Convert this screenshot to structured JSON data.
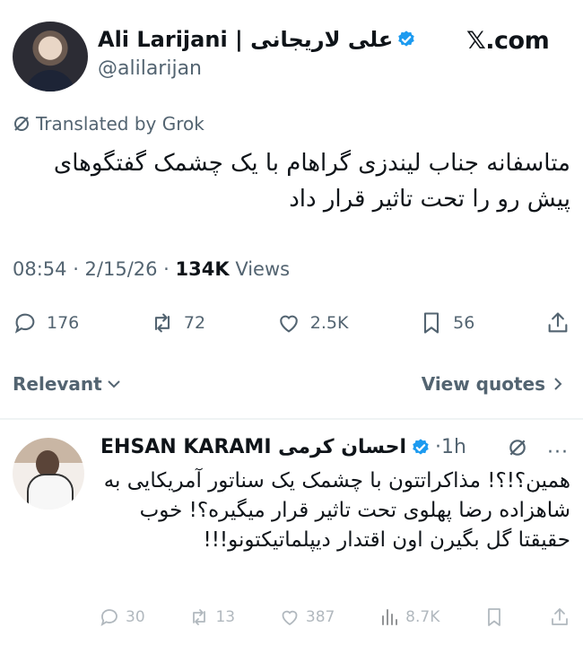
{
  "author": {
    "name": "Ali Larijani | علی لاریجانی",
    "handle": "@alilarijan"
  },
  "brand": "𝕏.com",
  "translated_label": "Translated by Grok",
  "tweet_text": "متاسفانه جناب لیندزی گراهام با یک چشمک گفتگوهای پیش رو را تحت تاثیر قرار داد",
  "meta": {
    "time_date": "08:54 · 2/15/26 · ",
    "views_count": "134K",
    "views_label": " Views"
  },
  "actions": {
    "replies": "176",
    "reposts": "72",
    "likes": "2.5K",
    "bookmarks": "56"
  },
  "sort": {
    "relevant_label": "Relevant",
    "view_quotes_label": "View quotes"
  },
  "reply": {
    "name": "EHSAN KARAMI احسان کرمی",
    "time": "·1h",
    "more": "···",
    "text": "همین؟!؟! مذاکراتتون با چشمک یک سناتور آمریکایی به شاهزاده رضا پهلوی تحت تاثیر قرار میگیره؟! خوب حقیقتا گل بگیرن اون اقتدار دیپلماتیکتونو!!!",
    "replies": "30",
    "reposts": "13",
    "likes": "387",
    "views": "8.7K"
  },
  "colors": {
    "text": "#0f1419",
    "secondary": "#536471",
    "verified": "#1d9bf0",
    "divider": "#eff3f4"
  }
}
